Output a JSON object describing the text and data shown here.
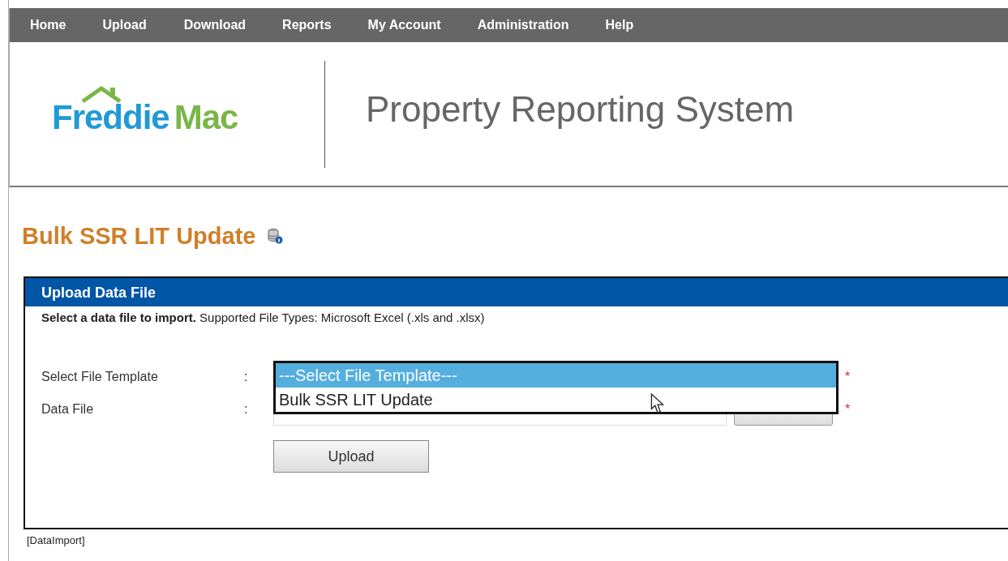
{
  "nav": [
    {
      "label": "Home"
    },
    {
      "label": "Upload"
    },
    {
      "label": "Download"
    },
    {
      "label": "Reports"
    },
    {
      "label": "My Account"
    },
    {
      "label": "Administration"
    },
    {
      "label": "Help"
    }
  ],
  "logo": {
    "first": "Freddie",
    "second": "Mac"
  },
  "system_title": "Property Reporting System",
  "page_title": "Bulk SSR LIT Update",
  "panel": {
    "title": "Upload Data File",
    "description": "**Select a data file to import.** Supported File Types: Microsoft Excel (.xls and .xlsx)",
    "fields": [
      {
        "label": "Select File Template",
        "separator": ":",
        "required_mark": "*",
        "kind": "dropdown",
        "options": [
          {
            "label": "---Select File Template---",
            "selected": true
          },
          {
            "label": "Bulk SSR LIT Update",
            "selected": false
          }
        ]
      },
      {
        "label": "Data File",
        "separator": ":",
        "required_mark": "*",
        "kind": "file"
      }
    ],
    "upload_button": "Upload"
  },
  "footer": "[DataImport]"
}
